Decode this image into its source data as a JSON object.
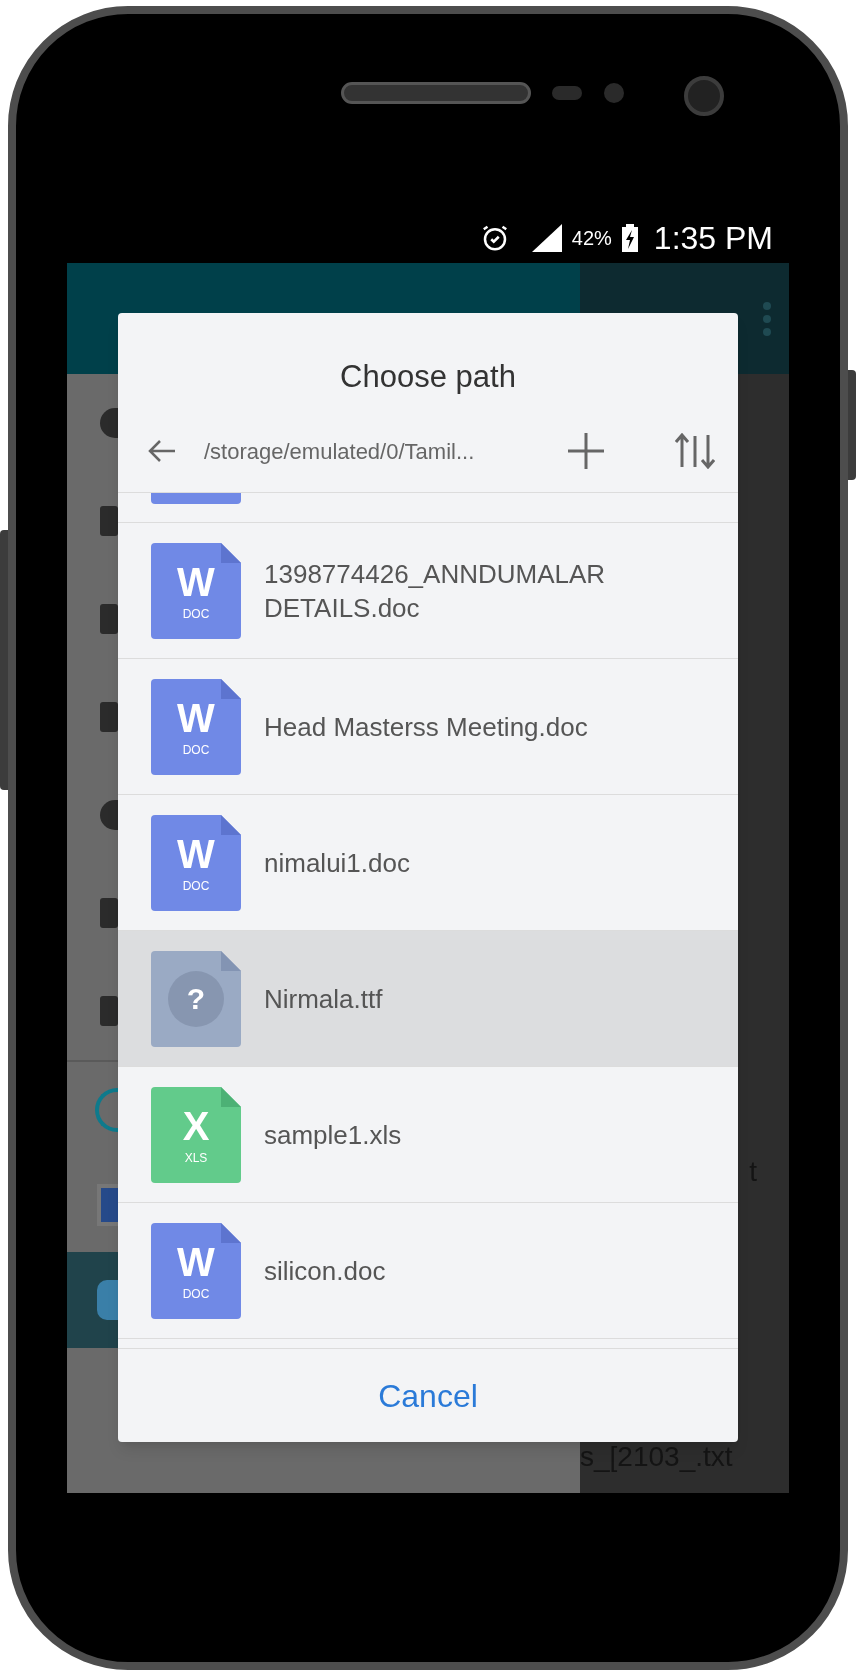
{
  "status_bar": {
    "battery": "42%",
    "time": "1:35 PM"
  },
  "background": {
    "right_texts": [
      "t",
      "s_[2103_.txt"
    ]
  },
  "dialog": {
    "title": "Choose path",
    "path": "/storage/emulated/0/Tamil...",
    "partial_top_item": {
      "kind": "doc"
    },
    "files": [
      {
        "kind": "doc",
        "glyph": "W",
        "badge": "DOC",
        "name": "1398774426_ANNDUMALAR DETAILS.doc",
        "selected": false
      },
      {
        "kind": "doc",
        "glyph": "W",
        "badge": "DOC",
        "name": "Head Masterss Meeting.doc",
        "selected": false
      },
      {
        "kind": "doc",
        "glyph": "W",
        "badge": "DOC",
        "name": "nimalui1.doc",
        "selected": false
      },
      {
        "kind": "unknown",
        "glyph": "?",
        "name": "Nirmala.ttf",
        "selected": true
      },
      {
        "kind": "xls",
        "glyph": "X",
        "badge": "XLS",
        "name": "sample1.xls",
        "selected": false
      },
      {
        "kind": "doc",
        "glyph": "W",
        "badge": "DOC",
        "name": "silicon.doc",
        "selected": false
      }
    ],
    "cancel": "Cancel"
  }
}
